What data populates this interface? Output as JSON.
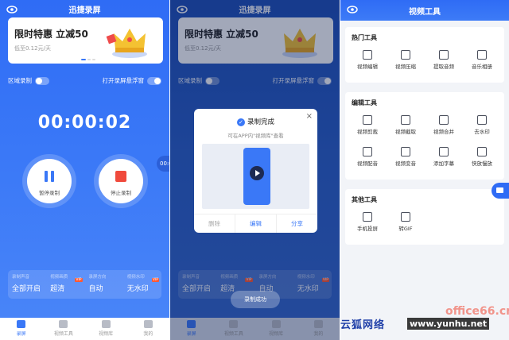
{
  "app": {
    "title": "迅捷录屏"
  },
  "banner": {
    "title": "限时特惠  立减50",
    "subtitle": "低至0.12元/天"
  },
  "record": {
    "region_label": "区域录制",
    "float_label": "打开录屏悬浮窗",
    "timer": "00:00:02",
    "pause_label": "暂停录制",
    "stop_label": "停止录制",
    "float_ball": "00:02"
  },
  "stats": [
    {
      "key": "录制声音",
      "value": "全部开启",
      "vip": ""
    },
    {
      "key": "视频画质",
      "value": "超清",
      "vip": "VIP"
    },
    {
      "key": "录屏方向",
      "value": "自动",
      "vip": ""
    },
    {
      "key": "视频水印",
      "value": "无水印",
      "vip": "VIP"
    }
  ],
  "tabs": [
    "录屏",
    "视频工具",
    "视频库",
    "我的"
  ],
  "modal": {
    "title": "录制完成",
    "subtitle": "可在APP内\"视频库\"查看",
    "delete": "删除",
    "edit": "编辑",
    "share": "分享"
  },
  "toast": "录制成功",
  "tools": {
    "title": "视频工具",
    "hot_title": "热门工具",
    "hot": [
      "视频编辑",
      "视频压缩",
      "提取音频",
      "音乐相册"
    ],
    "edit_title": "编辑工具",
    "edit": [
      "视频剪裁",
      "视频截取",
      "视频合并",
      "去水印",
      "视频配音",
      "视频变音",
      "添加字幕",
      "快放慢放"
    ],
    "other_title": "其他工具",
    "other": [
      "手机投屏",
      "转GIF"
    ]
  },
  "watermark": {
    "site": "云狐网络",
    "url": "www.yunhu.net",
    "brand": "office66.cn"
  },
  "colors": {
    "primary": "#3a78f7",
    "stop": "#f04a3c",
    "vip": "#ff5a36"
  }
}
